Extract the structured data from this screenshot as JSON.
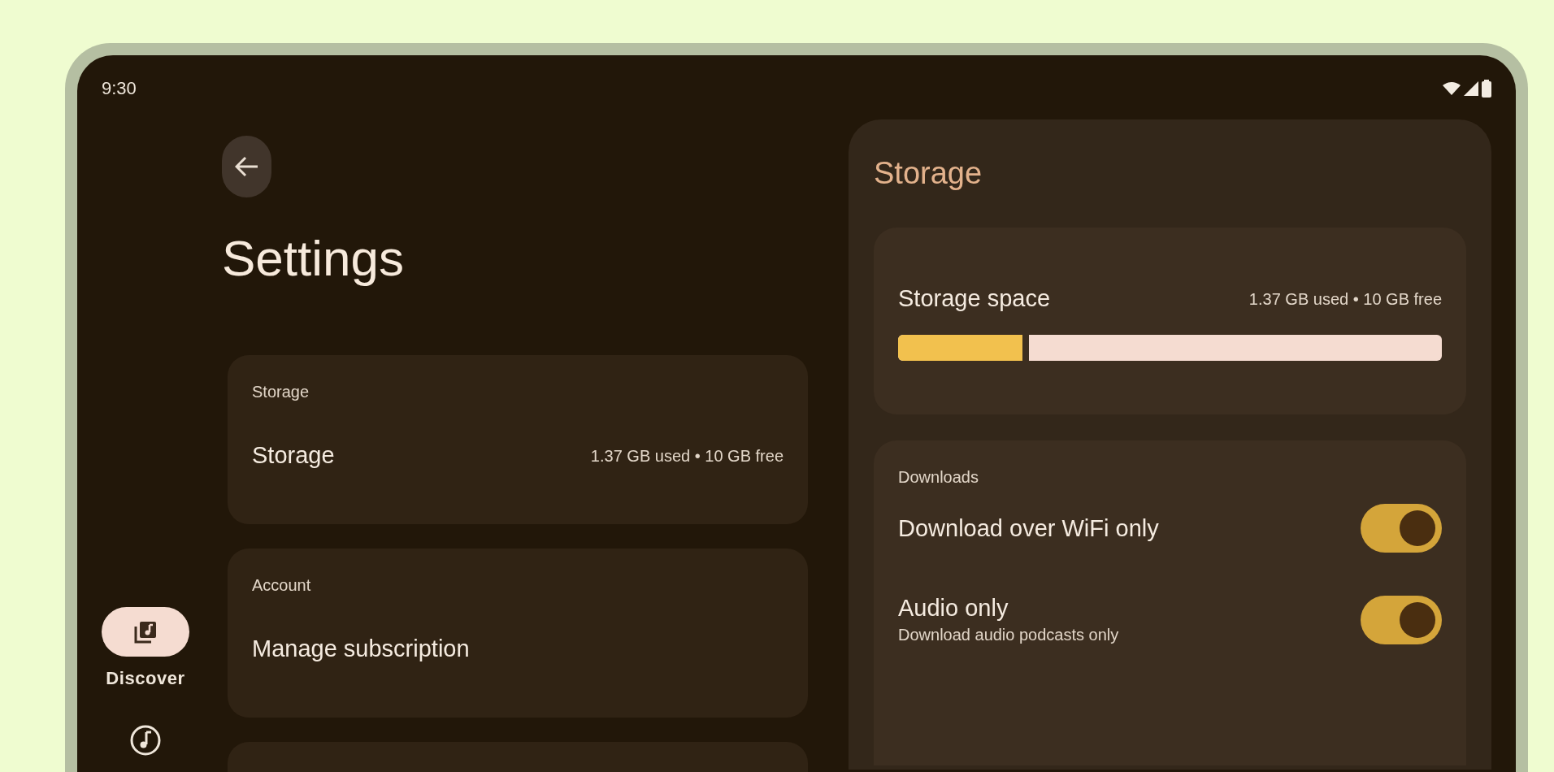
{
  "status_bar": {
    "time": "9:30"
  },
  "nav_rail": {
    "items": [
      {
        "kind": "library",
        "label": "Discover",
        "selected": true
      },
      {
        "kind": "music",
        "selected": false
      }
    ]
  },
  "header": {
    "title": "Settings"
  },
  "settings_groups": [
    {
      "heading": "Storage",
      "items": [
        {
          "label": "Storage",
          "value": "1.37 GB used • 10 GB free"
        }
      ]
    },
    {
      "heading": "Account",
      "items": [
        {
          "label": "Manage subscription"
        }
      ]
    }
  ],
  "detail_panel": {
    "title": "Storage",
    "storage": {
      "label": "Storage space",
      "reading": "1.37 GB used • 10 GB free",
      "level": 0.24
    },
    "downloads": {
      "heading": "Downloads",
      "items": [
        {
          "label": "Download over WiFi only",
          "on": true
        },
        {
          "label": "Audio only",
          "subtitle": "Download audio podcasts only",
          "on": true
        }
      ]
    }
  }
}
